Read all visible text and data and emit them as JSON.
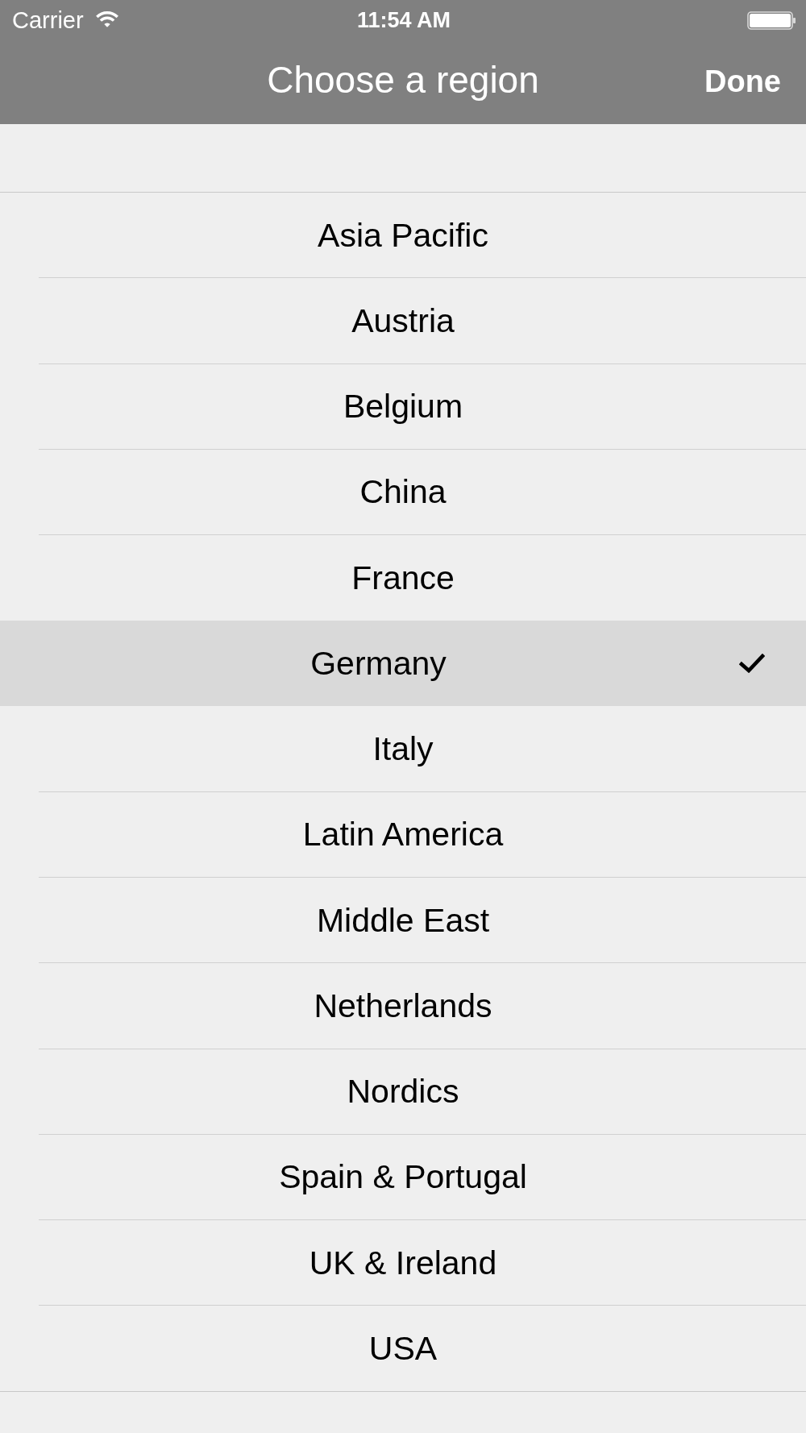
{
  "status_bar": {
    "carrier": "Carrier",
    "time": "11:54 AM"
  },
  "nav_bar": {
    "title": "Choose a region",
    "done_button": "Done"
  },
  "regions": [
    {
      "label": "Asia Pacific",
      "selected": false
    },
    {
      "label": "Austria",
      "selected": false
    },
    {
      "label": "Belgium",
      "selected": false
    },
    {
      "label": "China",
      "selected": false
    },
    {
      "label": "France",
      "selected": false
    },
    {
      "label": "Germany",
      "selected": true
    },
    {
      "label": "Italy",
      "selected": false
    },
    {
      "label": "Latin America",
      "selected": false
    },
    {
      "label": "Middle East",
      "selected": false
    },
    {
      "label": "Netherlands",
      "selected": false
    },
    {
      "label": "Nordics",
      "selected": false
    },
    {
      "label": "Spain & Portugal",
      "selected": false
    },
    {
      "label": "UK & Ireland",
      "selected": false
    },
    {
      "label": "USA",
      "selected": false
    }
  ]
}
